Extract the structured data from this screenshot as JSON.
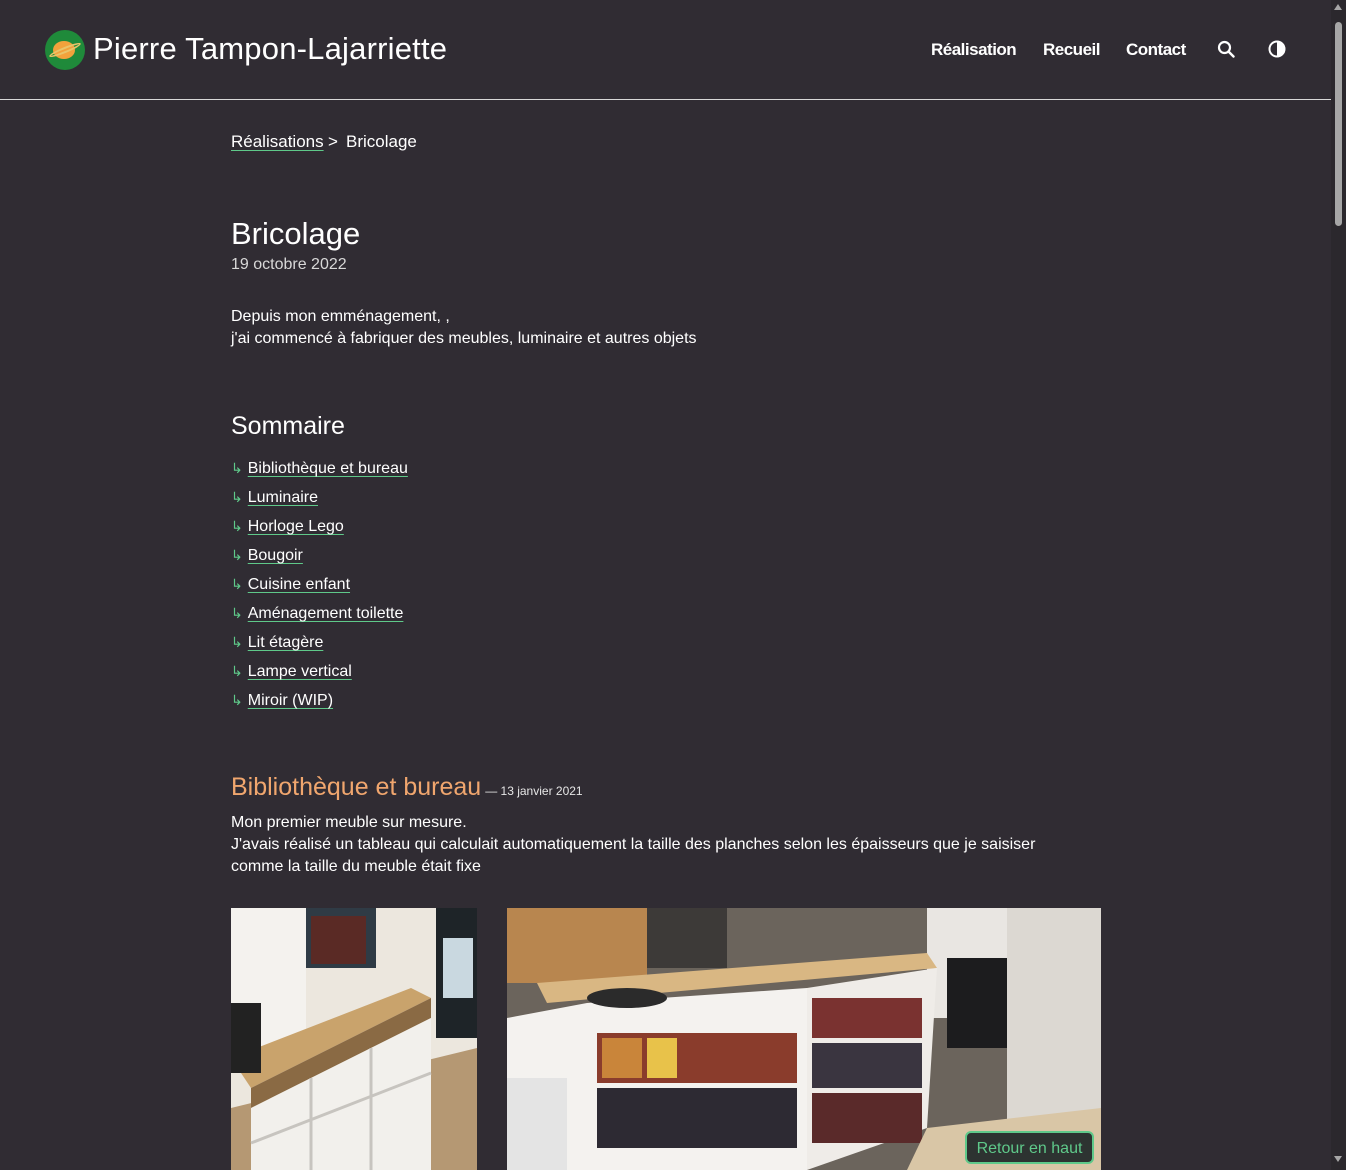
{
  "header": {
    "site_title": "Pierre Tampon-Lajarriette",
    "nav": [
      "Réalisation",
      "Recueil",
      "Contact"
    ]
  },
  "breadcrumb": {
    "parent": "Réalisations",
    "separator": ">",
    "current": "Bricolage"
  },
  "page": {
    "title": "Bricolage",
    "date": "19 octobre 2022",
    "intro_line1": "Depuis mon emménagement, ,",
    "intro_line2": "j'ai commencé à fabriquer des meubles, luminaire et autres objets"
  },
  "toc": {
    "heading": "Sommaire",
    "arrow": "↳",
    "items": [
      "Bibliothèque et bureau",
      "Luminaire",
      "Horloge Lego",
      "Bougoir",
      "Cuisine enfant",
      "Aménagement toilette",
      "Lit étagère",
      "Lampe vertical",
      "Miroir (WIP)"
    ]
  },
  "section": {
    "title": "Bibliothèque et bureau",
    "date": "— 13 janvier 2021",
    "line1": "Mon premier meuble sur mesure.",
    "line2": "J'avais réalisé un tableau qui calculait automatiquement la taille des planches selon les épaisseurs que je saisiser",
    "line3": "comme la taille du meuble était fixe"
  },
  "back_to_top": "Retour en haut",
  "colors": {
    "background": "#302c33",
    "accent_green": "#5fc98a",
    "section_orange": "#f0a66e"
  },
  "icons": [
    "saturn-logo-icon",
    "search-icon",
    "theme-toggle-icon"
  ]
}
